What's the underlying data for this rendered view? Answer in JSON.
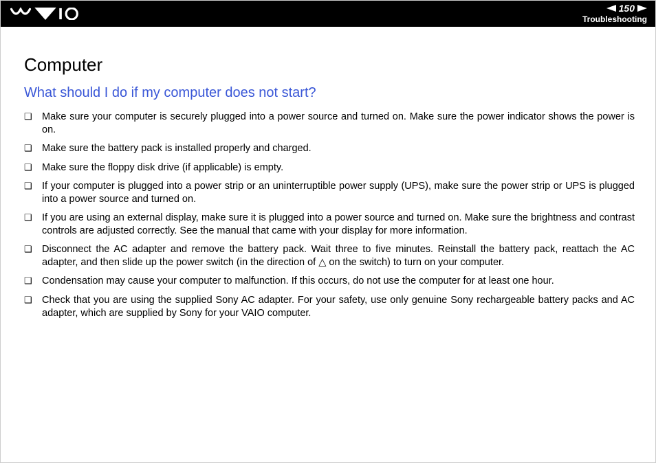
{
  "header": {
    "page_number": "150",
    "section": "Troubleshooting"
  },
  "content": {
    "title": "Computer",
    "subtitle": "What should I do if my computer does not start?",
    "items": [
      "Make sure your computer is securely plugged into a power source and turned on. Make sure the power indicator shows the power is on.",
      "Make sure the battery pack is installed properly and charged.",
      "Make sure the floppy disk drive (if applicable) is empty.",
      "If your computer is plugged into a power strip or an uninterruptible power supply (UPS), make sure the power strip or UPS is plugged into a power source and turned on.",
      "If you are using an external display, make sure it is plugged into a power source and turned on. Make sure the brightness and contrast controls are adjusted correctly. See the manual that came with your display for more information.",
      "Disconnect the AC adapter and remove the battery pack. Wait three to five minutes. Reinstall the battery pack, reattach the AC adapter, and then slide up the power switch (in the direction of △ on the switch) to turn on your computer.",
      "Condensation may cause your computer to malfunction. If this occurs, do not use the computer for at least one hour.",
      "Check that you are using the supplied Sony AC adapter. For your safety, use only genuine Sony rechargeable battery packs and AC adapter, which are supplied by Sony for your VAIO computer."
    ]
  }
}
